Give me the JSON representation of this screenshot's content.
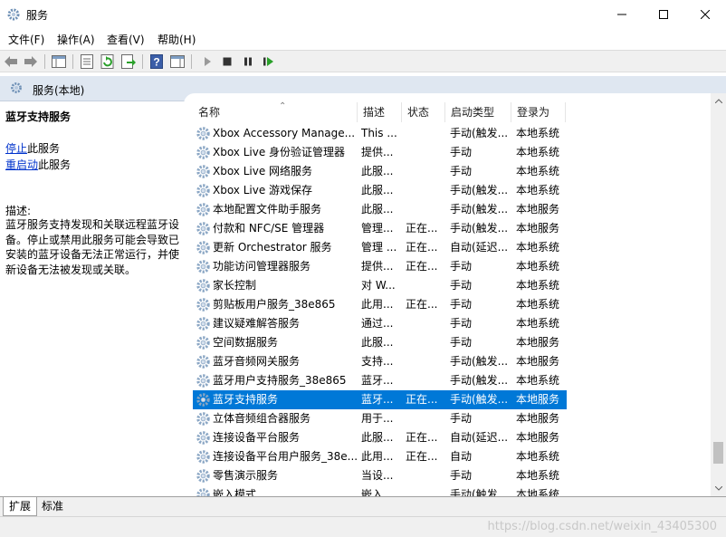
{
  "window": {
    "title": "服务"
  },
  "menu": [
    {
      "label": "文件(F)"
    },
    {
      "label": "操作(A)"
    },
    {
      "label": "查看(V)"
    },
    {
      "label": "帮助(H)"
    }
  ],
  "scope": {
    "title": "服务(本地)"
  },
  "detail": {
    "service_title": "蓝牙支持服务",
    "stop_link": "停止",
    "stop_suffix": "此服务",
    "restart_link": "重启动",
    "restart_suffix": "此服务",
    "desc_label": "描述:",
    "desc_text": "蓝牙服务支持发现和关联远程蓝牙设备。停止或禁用此服务可能会导致已安装的蓝牙设备无法正常运行，并使新设备无法被发现或关联。"
  },
  "columns": {
    "name": "名称",
    "desc": "描述",
    "status": "状态",
    "startup": "启动类型",
    "logon": "登录为"
  },
  "services": [
    {
      "name": "Xbox Accessory Manage...",
      "desc": "This ...",
      "status": "",
      "startup": "手动(触发...",
      "logon": "本地系统",
      "selected": false
    },
    {
      "name": "Xbox Live 身份验证管理器",
      "desc": "提供...",
      "status": "",
      "startup": "手动",
      "logon": "本地系统",
      "selected": false
    },
    {
      "name": "Xbox Live 网络服务",
      "desc": "此服...",
      "status": "",
      "startup": "手动",
      "logon": "本地系统",
      "selected": false
    },
    {
      "name": "Xbox Live 游戏保存",
      "desc": "此服...",
      "status": "",
      "startup": "手动(触发...",
      "logon": "本地系统",
      "selected": false
    },
    {
      "name": "本地配置文件助手服务",
      "desc": "此服...",
      "status": "",
      "startup": "手动(触发...",
      "logon": "本地服务",
      "selected": false
    },
    {
      "name": "付款和 NFC/SE 管理器",
      "desc": "管理...",
      "status": "正在...",
      "startup": "手动(触发...",
      "logon": "本地服务",
      "selected": false
    },
    {
      "name": "更新 Orchestrator 服务",
      "desc": "管理 ...",
      "status": "正在...",
      "startup": "自动(延迟...",
      "logon": "本地系统",
      "selected": false
    },
    {
      "name": "功能访问管理器服务",
      "desc": "提供...",
      "status": "正在...",
      "startup": "手动",
      "logon": "本地系统",
      "selected": false
    },
    {
      "name": "家长控制",
      "desc": "对 W...",
      "status": "",
      "startup": "手动",
      "logon": "本地系统",
      "selected": false
    },
    {
      "name": "剪贴板用户服务_38e865",
      "desc": "此用...",
      "status": "正在...",
      "startup": "手动",
      "logon": "本地系统",
      "selected": false
    },
    {
      "name": "建议疑难解答服务",
      "desc": "通过...",
      "status": "",
      "startup": "手动",
      "logon": "本地系统",
      "selected": false
    },
    {
      "name": "空间数据服务",
      "desc": "此服...",
      "status": "",
      "startup": "手动",
      "logon": "本地服务",
      "selected": false
    },
    {
      "name": "蓝牙音频网关服务",
      "desc": "支持...",
      "status": "",
      "startup": "手动(触发...",
      "logon": "本地服务",
      "selected": false
    },
    {
      "name": "蓝牙用户支持服务_38e865",
      "desc": "蓝牙...",
      "status": "",
      "startup": "手动(触发...",
      "logon": "本地系统",
      "selected": false
    },
    {
      "name": "蓝牙支持服务",
      "desc": "蓝牙...",
      "status": "正在...",
      "startup": "手动(触发...",
      "logon": "本地服务",
      "selected": true
    },
    {
      "name": "立体音频组合器服务",
      "desc": "用于...",
      "status": "",
      "startup": "手动",
      "logon": "本地服务",
      "selected": false
    },
    {
      "name": "连接设备平台服务",
      "desc": "此服...",
      "status": "正在...",
      "startup": "自动(延迟...",
      "logon": "本地服务",
      "selected": false
    },
    {
      "name": "连接设备平台用户服务_38e...",
      "desc": "此用...",
      "status": "正在...",
      "startup": "自动",
      "logon": "本地系统",
      "selected": false
    },
    {
      "name": "零售演示服务",
      "desc": "当设...",
      "status": "",
      "startup": "手动",
      "logon": "本地系统",
      "selected": false
    },
    {
      "name": "嵌入模式",
      "desc": "嵌入...",
      "status": "",
      "startup": "手动(触发...",
      "logon": "本地系统",
      "selected": false
    }
  ],
  "tabs": [
    {
      "label": "扩展"
    },
    {
      "label": "标准"
    }
  ],
  "watermark": "https://blog.csdn.net/weixin_43405300",
  "icons": {
    "toolbar": [
      "back-icon",
      "forward-icon",
      "show-hide-console-tree-icon",
      "properties-icon",
      "refresh-icon",
      "export-list-icon",
      "help-icon",
      "show-hide-action-pane-icon",
      "start-service-icon",
      "stop-service-icon",
      "pause-service-icon",
      "restart-service-icon"
    ]
  },
  "colors": {
    "selection": "#0078d7",
    "scope_bar": "#dfe7f1",
    "link": "#0033cc"
  }
}
